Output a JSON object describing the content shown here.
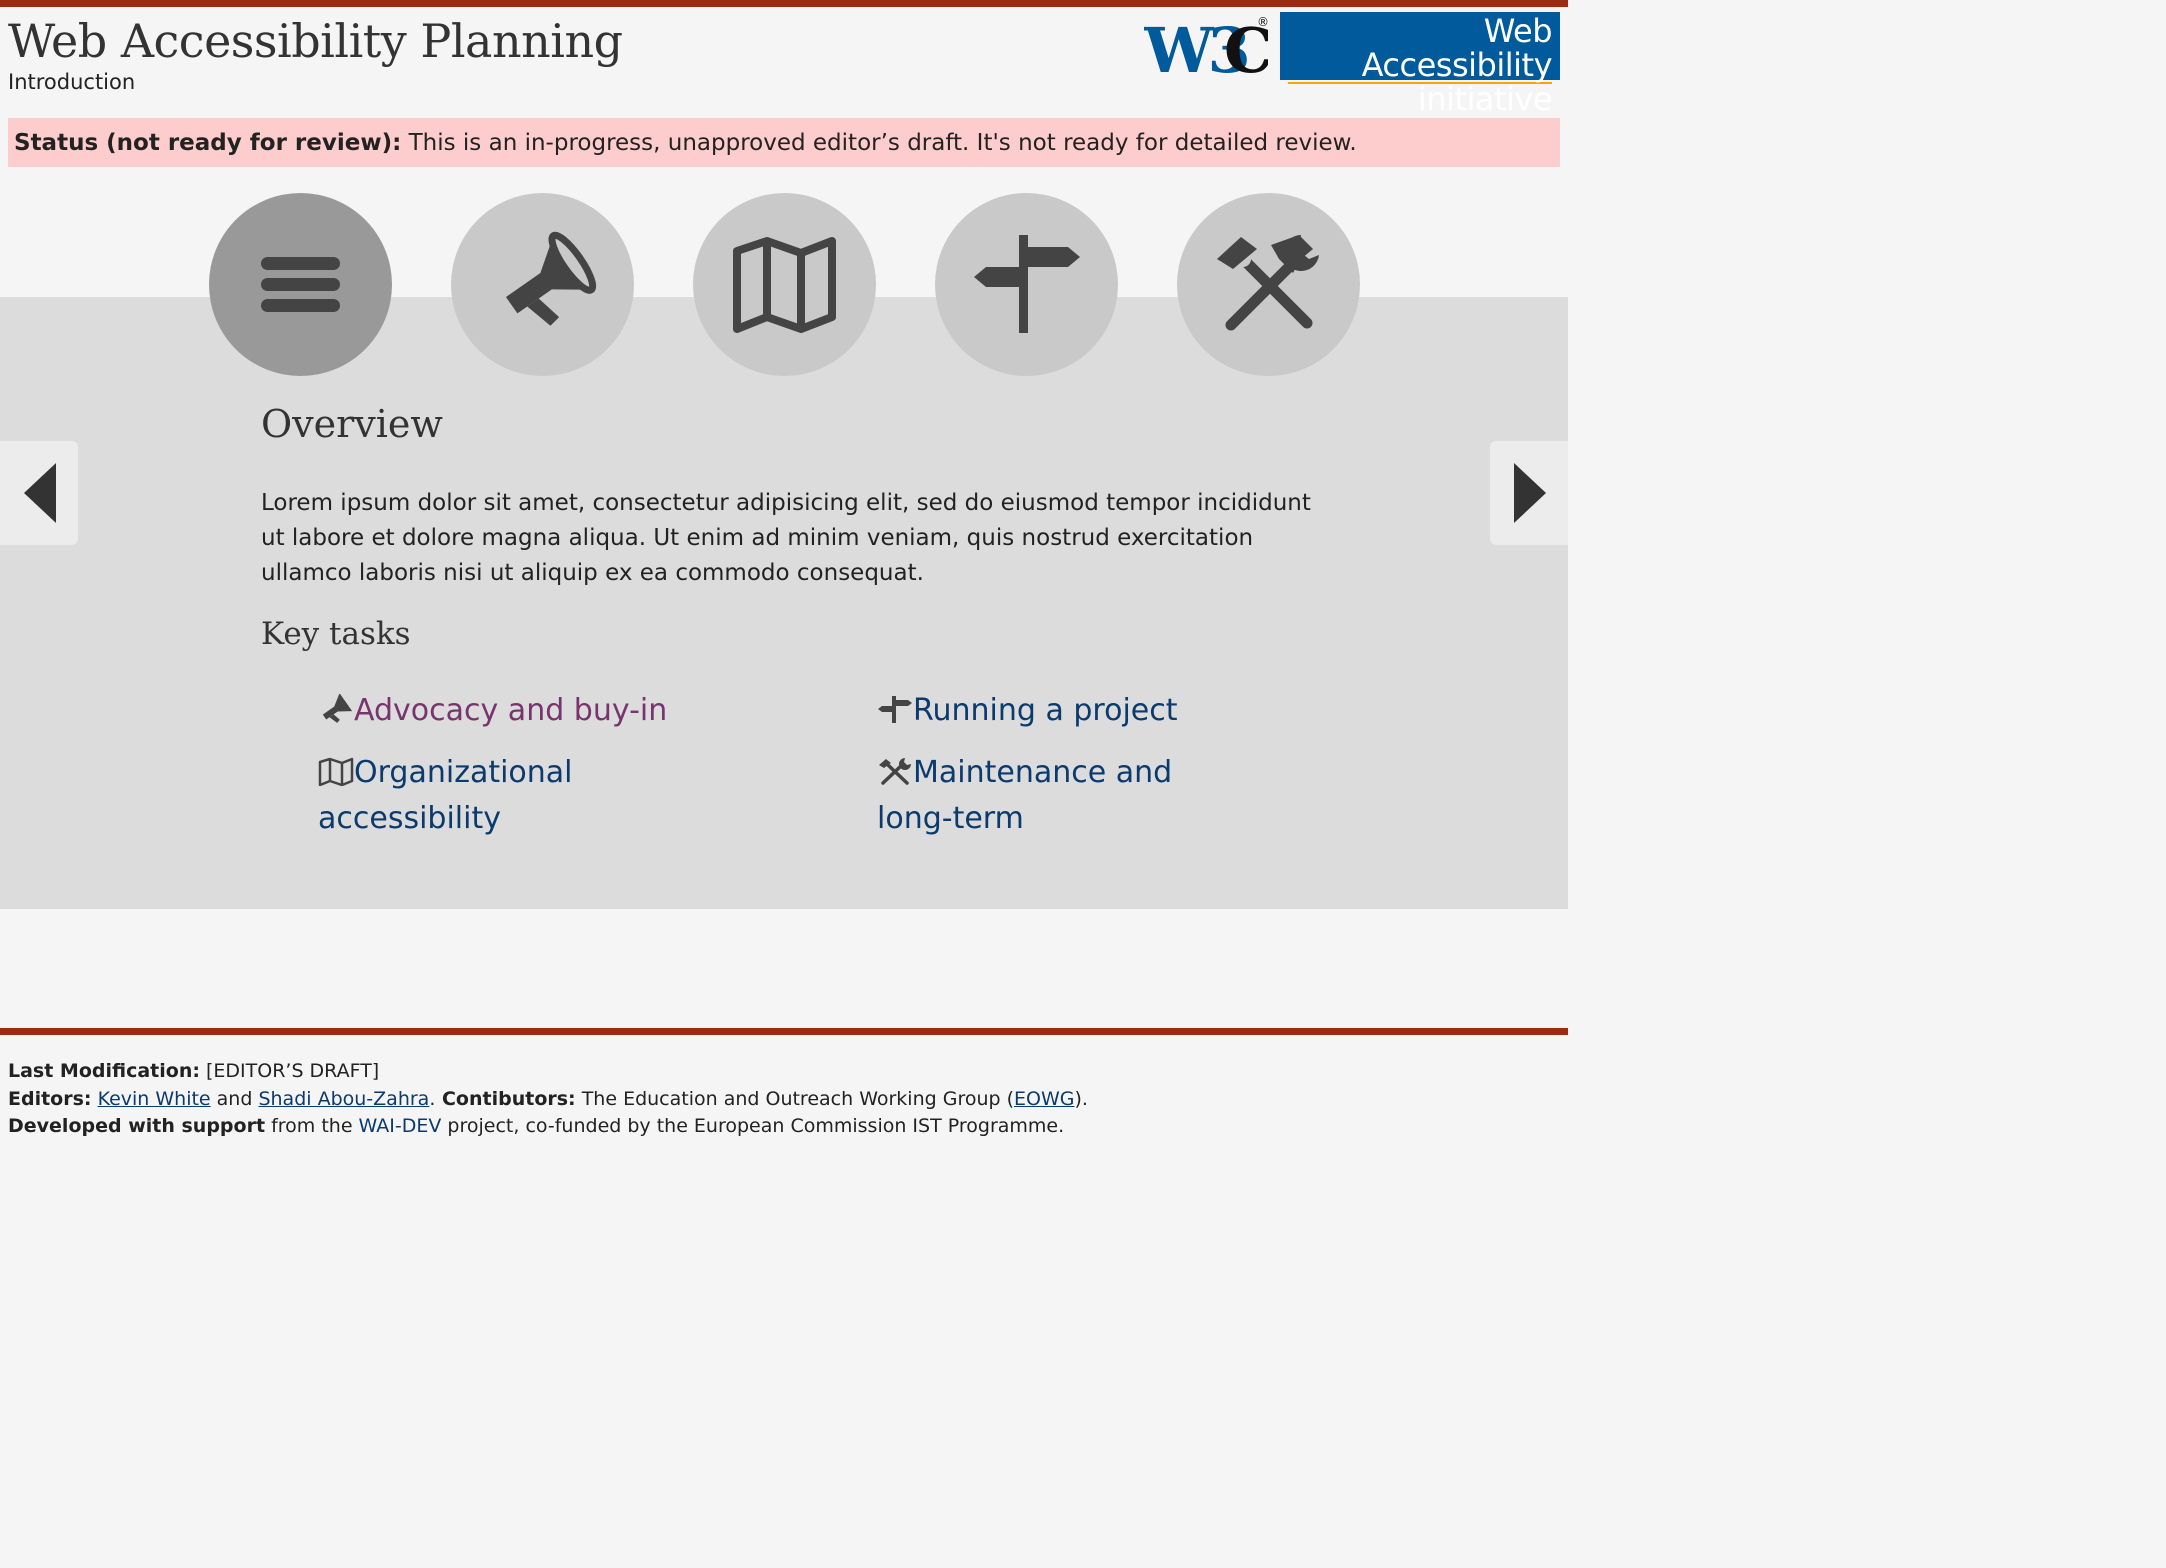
{
  "header": {
    "title": "Web Accessibility Planning",
    "subtitle": "Introduction",
    "w3c_logo_text": "W3C",
    "wai_logo_line1": "Web Accessibility",
    "wai_logo_line2": "initiative"
  },
  "status": {
    "label": "Status (not ready for review):",
    "text": " This is an in-progress, unapproved editor’s draft. It's not ready for detailed review."
  },
  "tabs": [
    {
      "icon": "menu-icon",
      "active": true
    },
    {
      "icon": "megaphone-icon",
      "active": false
    },
    {
      "icon": "map-icon",
      "active": false
    },
    {
      "icon": "signpost-icon",
      "active": false
    },
    {
      "icon": "tools-icon",
      "active": false
    }
  ],
  "panel": {
    "heading": "Overview",
    "text": "Lorem ipsum dolor sit amet, consectetur adipisicing elit, sed do eiusmod tempor incididunt ut labore et dolore magna aliqua. Ut enim ad minim veniam, quis nostrud exercitation ullamco laboris nisi ut aliquip ex ea commodo consequat.",
    "key_tasks_heading": "Key tasks",
    "tasks": [
      {
        "label": "Advocacy and buy-in",
        "icon": "megaphone-icon"
      },
      {
        "label": "Running a project",
        "icon": "signpost-icon"
      },
      {
        "label_line1": "Organizational",
        "label_line2": "accessibility",
        "icon": "map-icon"
      },
      {
        "label_line1": "Maintenance and",
        "label_line2": "long-term",
        "icon": "tools-icon"
      }
    ]
  },
  "nav": {
    "prev_icon": "arrow-left-icon",
    "next_icon": "arrow-right-icon"
  },
  "footer": {
    "last_mod_label": "Last Modification:",
    "last_mod_value": " [EDITOR’S DRAFT]",
    "editors_label": "Editors:",
    "editor1": "Kevin White",
    "and": " and ",
    "editor2": "Shadi Abou-Zahra",
    "period": ".",
    "contributors_label": " Contibutors:",
    "contributors_text": " The Education and Outreach Working Group (",
    "eowg": "EOWG",
    "close": ").",
    "support_label": "Developed with support",
    "support_text1": " from the ",
    "waidev": "WAI-DEV",
    "support_text2": " project, co-funded by the European Commission IST Programme."
  },
  "colors": {
    "accent_bar": "#9e2a11",
    "link": "#0b3a6e",
    "visited_link": "#78346e",
    "status_bg": "#fdcdcd",
    "panel_bg": "#dcdcdc",
    "tab_bg": "#c9c9c9",
    "tab_active_bg": "#999999",
    "wai_blue": "#005a9c"
  }
}
